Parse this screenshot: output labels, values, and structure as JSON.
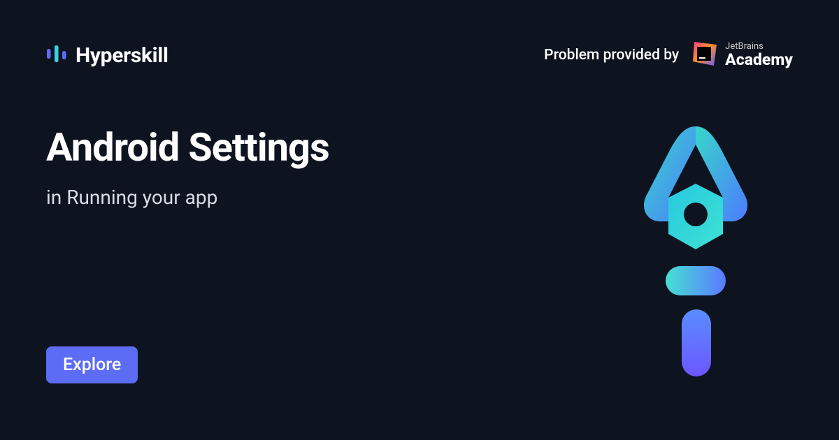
{
  "brand": {
    "name": "Hyperskill"
  },
  "provider": {
    "label": "Problem provided by",
    "partner_top": "JetBrains",
    "partner_bottom": "Academy"
  },
  "main": {
    "title": "Android Settings",
    "subtitle": "in Running your app"
  },
  "cta": {
    "explore_label": "Explore"
  }
}
